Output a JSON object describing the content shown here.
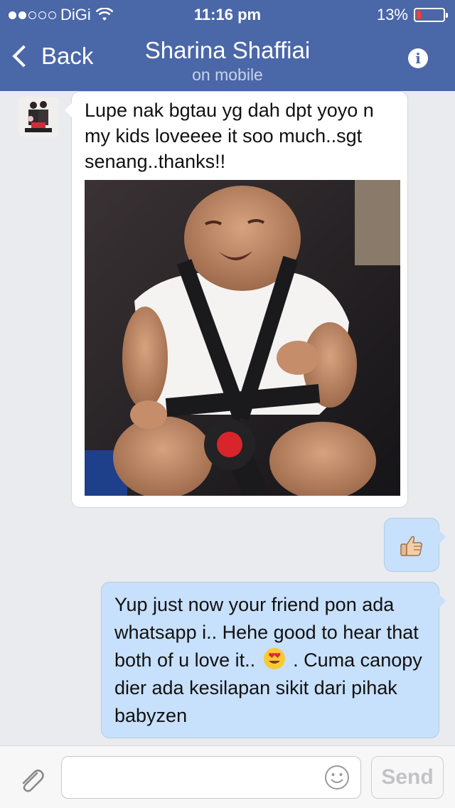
{
  "status_bar": {
    "carrier": "DiGi",
    "time": "11:16 pm",
    "battery": "13%",
    "signal_bars_filled": 2,
    "signal_bars_total": 5
  },
  "nav": {
    "back_label": "Back",
    "title": "Sharina Shaffiai",
    "subtitle": "on mobile",
    "info_icon": "info-icon"
  },
  "messages": [
    {
      "direction": "incoming",
      "text": "Lupe nak bgtau yg dah dpt yoyo n my kids loveeee it soo much..sgt senang..thanks!!",
      "attachment": "photo"
    },
    {
      "direction": "outgoing",
      "sticker": "thumbs-up-icon"
    },
    {
      "direction": "outgoing",
      "text_before_emoji": "Yup just now your friend pon ada whatsapp i.. Hehe good to hear that both of u love it..",
      "emoji": "heart-eyes-emoji",
      "text_after_emoji": ". Cuma canopy dier ada kesilapan sikit dari pihak babyzen"
    }
  ],
  "composer": {
    "input_value": "",
    "send_label": "Send"
  },
  "colors": {
    "nav_bar": "#4a67a8",
    "outgoing_bubble": "#c7e0fb",
    "incoming_bubble": "#ffffff",
    "background": "#e9ebee",
    "battery_low": "#ff3b30"
  }
}
